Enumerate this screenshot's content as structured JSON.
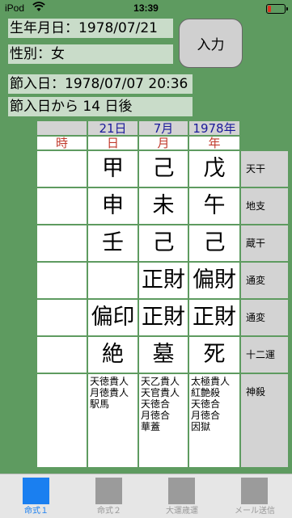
{
  "status": {
    "carrier": "iPod",
    "time": "13:39"
  },
  "info": {
    "birth": "生年月日：1978/07/21",
    "gender": "性別：女",
    "setsuiri": "節入日：1978/07/07 20:36",
    "days": "節入日から 14 日後"
  },
  "input_button": "入力",
  "headers": {
    "day_date": "21日",
    "month_date": "7月",
    "year_date": "1978年",
    "hour": "時",
    "day": "日",
    "month": "月",
    "year": "年"
  },
  "rows": [
    {
      "hour": "",
      "day": "甲",
      "month": "己",
      "year": "戊",
      "label": "天干"
    },
    {
      "hour": "",
      "day": "申",
      "month": "未",
      "year": "午",
      "label": "地支"
    },
    {
      "hour": "",
      "day": "壬",
      "month": "己",
      "year": "己",
      "label": "蔵干"
    },
    {
      "hour": "",
      "day": "",
      "month": "正財",
      "year": "偏財",
      "label": "通変"
    },
    {
      "hour": "",
      "day": "偏印",
      "month": "正財",
      "year": "正財",
      "label": "通変"
    },
    {
      "hour": "",
      "day": "絶",
      "month": "墓",
      "year": "死",
      "label": "十二運"
    }
  ],
  "shinsatsu": {
    "label": "神殺",
    "day": [
      "天徳貴人",
      "月徳貴人",
      "駅馬"
    ],
    "month": [
      "天乙貴人",
      "天官貴人",
      "天徳合",
      "月徳合",
      "華蓋"
    ],
    "year": [
      "太極貴人",
      "紅艶殺",
      "天徳合",
      "月徳合",
      "因獄"
    ]
  },
  "tabs": [
    {
      "label": "命式１",
      "active": true
    },
    {
      "label": "命式２",
      "active": false
    },
    {
      "label": "大運歳運",
      "active": false
    },
    {
      "label": "メール送信",
      "active": false
    }
  ]
}
